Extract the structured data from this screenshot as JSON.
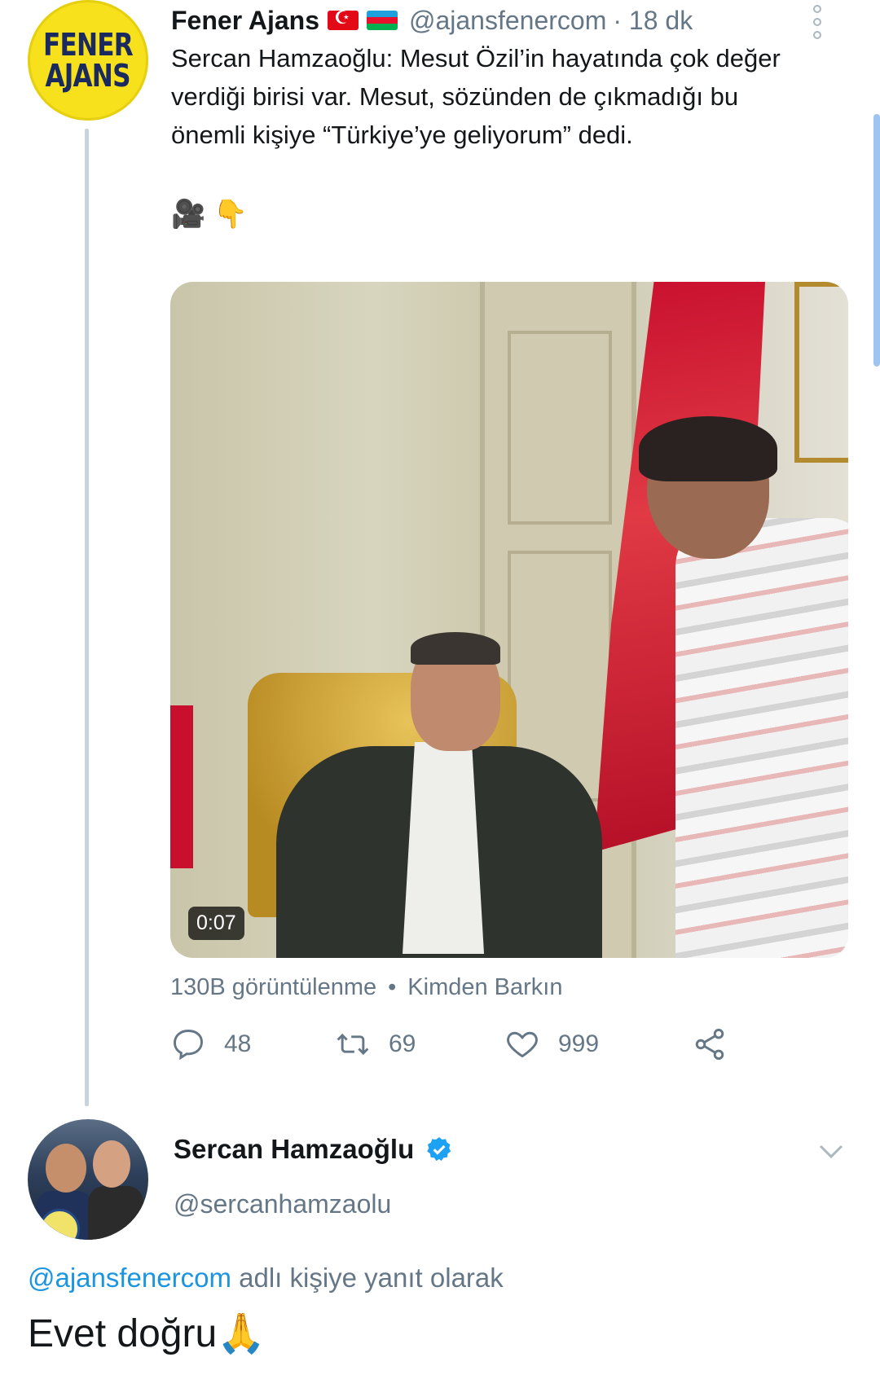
{
  "tweet": {
    "avatar_text_line1": "FENER",
    "avatar_text_line2": "AJANS",
    "author_name": "Fener Ajans",
    "author_handle": "@ajansfenercom",
    "time": "· 18 dk",
    "text": "Sercan Hamzaoğlu: Mesut Özil’in hayatında çok değer verdiği birisi var. Mesut, sözünden de çıkmadığı bu önemli kişiye “Türkiye’ye geliyorum” dedi.",
    "emojis": "🎥 👇",
    "video_duration": "0:07",
    "views": "130B görüntülenme",
    "source": "Kimden Barkın",
    "reply_count": "48",
    "retweet_count": "69",
    "like_count": "999"
  },
  "reply": {
    "author_name": "Sercan Hamzaoğlu",
    "author_handle": "@sercanhamzaolu",
    "reply_to_handle": "@ajansfenercom",
    "reply_to_suffix": " adlı kişiye yanıt olarak",
    "text": "Evet doğru🙏"
  },
  "colors": {
    "link": "#1b95e0",
    "secondary_text": "#657786",
    "verified": "#1da1f2"
  }
}
